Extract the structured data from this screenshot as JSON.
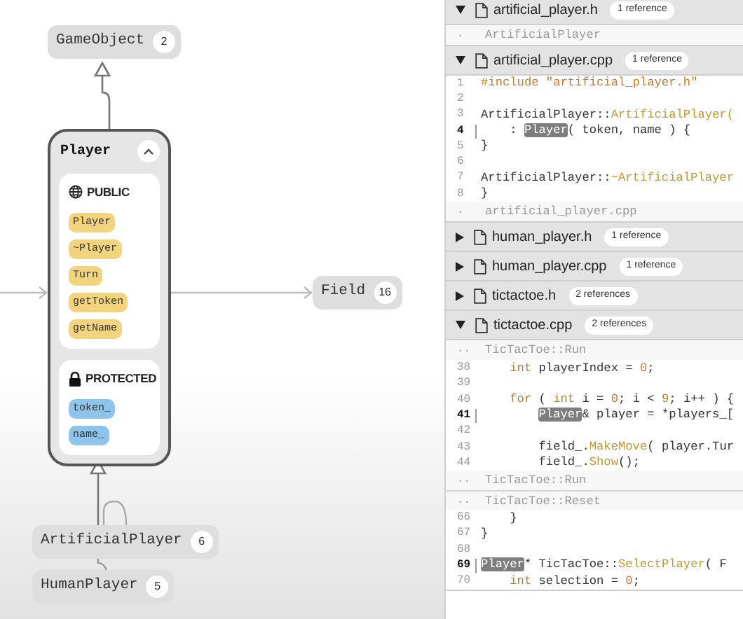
{
  "diagram": {
    "nodes": [
      {
        "kind": "node",
        "label": "GameObject",
        "count": "2"
      },
      {
        "kind": "node",
        "label": "Field",
        "count": "16"
      },
      {
        "kind": "node",
        "label": "ArtificialPlayer",
        "count": "6"
      },
      {
        "kind": "node",
        "label": "HumanPlayer",
        "count": "5"
      }
    ],
    "class_card": {
      "title": "Player",
      "expanded": true,
      "sections": [
        {
          "kind": "public",
          "label": "PUBLIC",
          "members": [
            "Player",
            "~Player",
            "Turn",
            "getToken",
            "getName"
          ]
        },
        {
          "kind": "protected",
          "label": "PROTECTED",
          "members": [
            "token_",
            "name_"
          ]
        }
      ]
    }
  },
  "references": {
    "files": [
      {
        "name": "artificial_player.h",
        "refs": "1 reference",
        "expanded": true,
        "lines": [
          {
            "kind": "context",
            "number": ".",
            "text": "ArtificialPlayer"
          }
        ]
      },
      {
        "name": "artificial_player.cpp",
        "refs": "1 reference",
        "expanded": true,
        "lines": [
          {
            "kind": "code",
            "number": "1",
            "current": false,
            "segments": [
              {
                "kind": "keyword",
                "text": "#include "
              },
              {
                "kind": "string",
                "text": "\"artificial_player.h\""
              }
            ]
          },
          {
            "kind": "code",
            "number": "2",
            "current": false
          },
          {
            "kind": "code",
            "number": "3",
            "current": false,
            "segments": [
              {
                "kind": "plain",
                "text": "ArtificialPlayer::"
              },
              {
                "kind": "func",
                "text": "ArtificialPlayer("
              }
            ]
          },
          {
            "kind": "code",
            "number": "4",
            "current": true,
            "segments": [
              {
                "kind": "plain",
                "text": "    : "
              },
              {
                "kind": "match",
                "text": "Player"
              },
              {
                "kind": "plain",
                "text": "( token, name ) {"
              }
            ]
          },
          {
            "kind": "code",
            "number": "5",
            "current": false,
            "segments": [
              {
                "kind": "plain",
                "text": "}"
              }
            ]
          },
          {
            "kind": "code",
            "number": "6",
            "current": false
          },
          {
            "kind": "code",
            "number": "7",
            "current": false,
            "segments": [
              {
                "kind": "plain",
                "text": "ArtificialPlayer::"
              },
              {
                "kind": "func",
                "text": "~ArtificialPlayer"
              }
            ]
          },
          {
            "kind": "code",
            "number": "8",
            "current": false,
            "segments": [
              {
                "kind": "plain",
                "text": "}"
              }
            ]
          },
          {
            "kind": "context",
            "number": ".",
            "text": "artificial_player.cpp"
          }
        ]
      },
      {
        "name": "human_player.h",
        "refs": "1 reference",
        "expanded": false
      },
      {
        "name": "human_player.cpp",
        "refs": "1 reference",
        "expanded": false
      },
      {
        "name": "tictactoe.h",
        "refs": "2 references",
        "expanded": false
      },
      {
        "name": "tictactoe.cpp",
        "refs": "2 references",
        "expanded": true,
        "lines": [
          {
            "kind": "context",
            "number": "..",
            "text": "TicTacToe::Run"
          },
          {
            "kind": "code",
            "number": "38",
            "current": false,
            "segments": [
              {
                "kind": "keyword",
                "text": "    int"
              },
              {
                "kind": "plain",
                "text": " playerIndex = "
              },
              {
                "kind": "number",
                "text": "0"
              },
              {
                "kind": "plain",
                "text": ";"
              }
            ]
          },
          {
            "kind": "code",
            "number": "39",
            "current": false
          },
          {
            "kind": "code",
            "number": "40",
            "current": false,
            "segments": [
              {
                "kind": "keyword",
                "text": "    for"
              },
              {
                "kind": "plain",
                "text": " ( "
              },
              {
                "kind": "keyword",
                "text": "int"
              },
              {
                "kind": "plain",
                "text": " i = "
              },
              {
                "kind": "number",
                "text": "0"
              },
              {
                "kind": "plain",
                "text": "; i < "
              },
              {
                "kind": "number",
                "text": "9"
              },
              {
                "kind": "plain",
                "text": "; i++ ) {"
              }
            ]
          },
          {
            "kind": "code",
            "number": "41",
            "current": true,
            "segments": [
              {
                "kind": "match",
                "text": "Player",
                "indented": true
              },
              {
                "kind": "plain",
                "text": "& player = *players_["
              }
            ]
          },
          {
            "kind": "code",
            "number": "42",
            "current": false
          },
          {
            "kind": "code",
            "number": "43",
            "current": false,
            "segments": [
              {
                "kind": "plain",
                "text": "        field_."
              },
              {
                "kind": "func",
                "text": "MakeMove"
              },
              {
                "kind": "plain",
                "text": "( player.Tur"
              }
            ]
          },
          {
            "kind": "code",
            "number": "44",
            "current": false,
            "segments": [
              {
                "kind": "plain",
                "text": "        field_."
              },
              {
                "kind": "func",
                "text": "Show"
              },
              {
                "kind": "plain",
                "text": "();"
              }
            ]
          },
          {
            "kind": "context",
            "number": "..",
            "text": "TicTacToe::Run"
          },
          {
            "kind": "context",
            "number": "..",
            "text": "TicTacToe::Reset"
          },
          {
            "kind": "code",
            "number": "66",
            "current": false,
            "segments": [
              {
                "kind": "plain",
                "text": "    }"
              }
            ]
          },
          {
            "kind": "code",
            "number": "67",
            "current": false,
            "segments": [
              {
                "kind": "plain",
                "text": "}"
              }
            ]
          },
          {
            "kind": "code",
            "number": "68",
            "current": false
          },
          {
            "kind": "code",
            "number": "69",
            "current": true,
            "segments": [
              {
                "kind": "match",
                "text": "Player"
              },
              {
                "kind": "plain",
                "text": "* TicTacToe::"
              },
              {
                "kind": "func",
                "text": "SelectPlayer"
              },
              {
                "kind": "plain",
                "text": "( F"
              }
            ]
          },
          {
            "kind": "code",
            "number": "70",
            "current": false,
            "segments": [
              {
                "kind": "keyword",
                "text": "    int"
              },
              {
                "kind": "plain",
                "text": " selection = "
              },
              {
                "kind": "number",
                "text": "0"
              },
              {
                "kind": "plain",
                "text": ";"
              }
            ]
          }
        ]
      }
    ]
  }
}
